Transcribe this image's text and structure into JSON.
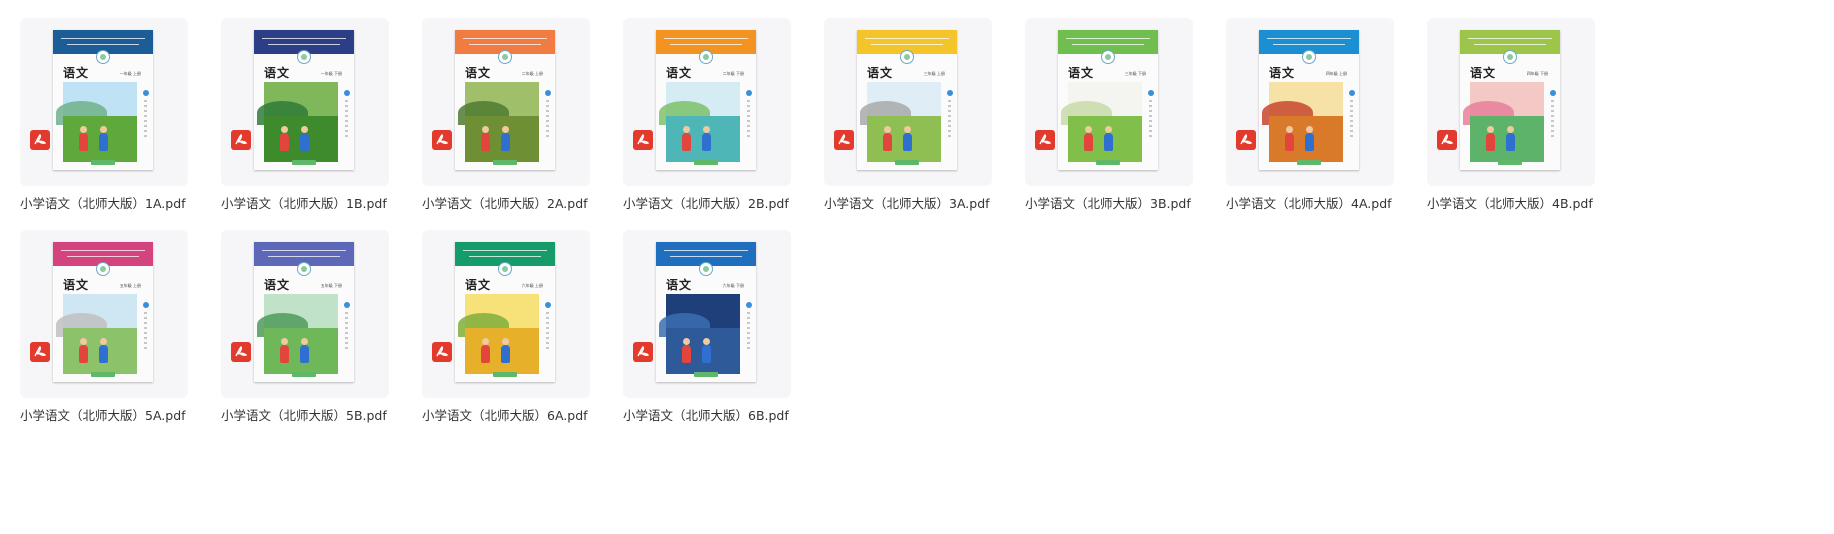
{
  "files": [
    {
      "name": "小学语文（北师大版）1A.pdf",
      "cover_title": "语文",
      "cover_grade": "一年级 上册",
      "band_color": "#1d5d97",
      "sky_color": "#bfe3f5",
      "ground_color": "#5ea83c",
      "hill_color": "#6fb28a",
      "icon": "pdf-file-icon"
    },
    {
      "name": "小学语文（北师大版）1B.pdf",
      "cover_title": "语文",
      "cover_grade": "一年级 下册",
      "band_color": "#2c3f86",
      "sky_color": "#7fb85a",
      "ground_color": "#3e8b2e",
      "hill_color": "#2f7a3a",
      "icon": "pdf-file-icon"
    },
    {
      "name": "小学语文（北师大版）2A.pdf",
      "cover_title": "语文",
      "cover_grade": "二年级 上册",
      "band_color": "#f07c41",
      "sky_color": "#9fbf6a",
      "ground_color": "#6f8f34",
      "hill_color": "#4f7a30",
      "icon": "pdf-file-icon"
    },
    {
      "name": "小学语文（北师大版）2B.pdf",
      "cover_title": "语文",
      "cover_grade": "二年级 下册",
      "band_color": "#f39321",
      "sky_color": "#d6ecf4",
      "ground_color": "#4fb6b8",
      "hill_color": "#7cc26a",
      "icon": "pdf-file-icon"
    },
    {
      "name": "小学语文（北师大版）3A.pdf",
      "cover_title": "语文",
      "cover_grade": "三年级 上册",
      "band_color": "#f3c52a",
      "sky_color": "#dfeef6",
      "ground_color": "#8fbf53",
      "hill_color": "#a9a9a9",
      "icon": "pdf-file-icon"
    },
    {
      "name": "小学语文（北师大版）3B.pdf",
      "cover_title": "语文",
      "cover_grade": "三年级 下册",
      "band_color": "#6fbe4e",
      "sky_color": "#f4f4f0",
      "ground_color": "#7fbf4a",
      "hill_color": "#c9d9a9",
      "icon": "pdf-file-icon"
    },
    {
      "name": "小学语文（北师大版）4A.pdf",
      "cover_title": "语文",
      "cover_grade": "四年级 上册",
      "band_color": "#1b8fd2",
      "sky_color": "#f6e1a6",
      "ground_color": "#d97a2b",
      "hill_color": "#c8452e",
      "icon": "pdf-file-icon"
    },
    {
      "name": "小学语文（北师大版）4B.pdf",
      "cover_title": "语文",
      "cover_grade": "四年级 下册",
      "band_color": "#9cc54a",
      "sky_color": "#f4c8c4",
      "ground_color": "#5eb36a",
      "hill_color": "#e77f9a",
      "icon": "pdf-file-icon"
    },
    {
      "name": "小学语文（北师大版）5A.pdf",
      "cover_title": "语文",
      "cover_grade": "五年级 上册",
      "band_color": "#d3447f",
      "sky_color": "#cfe6f3",
      "ground_color": "#8cc26a",
      "hill_color": "#bfbfbf",
      "icon": "pdf-file-icon"
    },
    {
      "name": "小学语文（北师大版）5B.pdf",
      "cover_title": "语文",
      "cover_grade": "五年级 下册",
      "band_color": "#5d69b8",
      "sky_color": "#bfe2c9",
      "ground_color": "#6fb85a",
      "hill_color": "#4f9a5a",
      "icon": "pdf-file-icon"
    },
    {
      "name": "小学语文（北师大版）6A.pdf",
      "cover_title": "语文",
      "cover_grade": "六年级 上册",
      "band_color": "#169c6a",
      "sky_color": "#f7e27a",
      "ground_color": "#e7b02a",
      "hill_color": "#7fae3a",
      "icon": "pdf-file-icon"
    },
    {
      "name": "小学语文（北师大版）6B.pdf",
      "cover_title": "语文",
      "cover_grade": "六年级 下册",
      "band_color": "#1f6fbe",
      "sky_color": "#1f3f7a",
      "ground_color": "#2e5a9a",
      "hill_color": "#3b6fb0",
      "icon": "pdf-file-icon"
    }
  ]
}
